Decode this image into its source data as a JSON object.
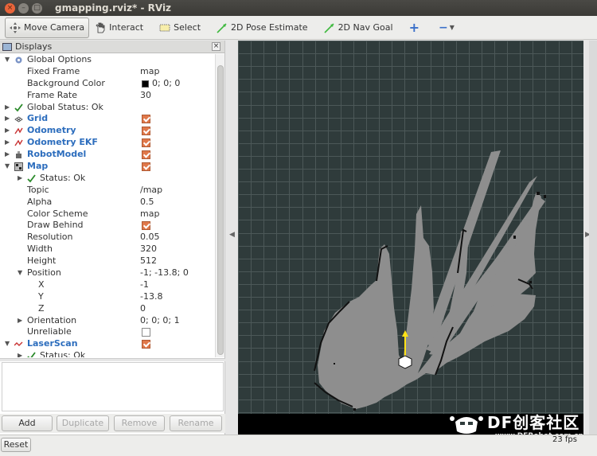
{
  "window": {
    "title": "gmapping.rviz* - RViz",
    "close_glyph": "×",
    "min_glyph": "–",
    "max_glyph": "□"
  },
  "toolbar": {
    "move_camera": "Move Camera",
    "interact": "Interact",
    "select": "Select",
    "pose_estimate": "2D Pose Estimate",
    "nav_goal": "2D Nav Goal",
    "add_tool": "+",
    "remove_tool": "−"
  },
  "displays_panel": {
    "title": "Displays",
    "close_glyph": "×",
    "rows": [
      {
        "depth": 0,
        "arrow": "▼",
        "icon": "gear",
        "label": "Global Options",
        "value": "",
        "style": "plain"
      },
      {
        "depth": 1,
        "label": "Fixed Frame",
        "value": "map"
      },
      {
        "depth": 1,
        "label": "Background Color",
        "value": "0; 0; 0",
        "swatch": "#000000"
      },
      {
        "depth": 1,
        "label": "Frame Rate",
        "value": "30"
      },
      {
        "depth": 0,
        "arrow": "▶",
        "icon": "check",
        "label": "Global Status: Ok",
        "value": ""
      },
      {
        "depth": 0,
        "arrow": "▶",
        "icon": "grid",
        "label": "Grid",
        "check": true,
        "style": "blue"
      },
      {
        "depth": 0,
        "arrow": "▶",
        "icon": "odom",
        "label": "Odometry",
        "check": true,
        "style": "blue"
      },
      {
        "depth": 0,
        "arrow": "▶",
        "icon": "odom",
        "label": "Odometry EKF",
        "check": true,
        "style": "blue"
      },
      {
        "depth": 0,
        "arrow": "▶",
        "icon": "robot",
        "label": "RobotModel",
        "check": true,
        "style": "blue"
      },
      {
        "depth": 0,
        "arrow": "▼",
        "icon": "map",
        "label": "Map",
        "check": true,
        "style": "blue"
      },
      {
        "depth": 1,
        "arrow": "▶",
        "icon": "check",
        "label": "Status: Ok",
        "value": ""
      },
      {
        "depth": 1,
        "label": "Topic",
        "value": "/map"
      },
      {
        "depth": 1,
        "label": "Alpha",
        "value": "0.5"
      },
      {
        "depth": 1,
        "label": "Color Scheme",
        "value": "map"
      },
      {
        "depth": 1,
        "label": "Draw Behind",
        "check": true
      },
      {
        "depth": 1,
        "label": "Resolution",
        "value": "0.05"
      },
      {
        "depth": 1,
        "label": "Width",
        "value": "320"
      },
      {
        "depth": 1,
        "label": "Height",
        "value": "512"
      },
      {
        "depth": 1,
        "arrow": "▼",
        "label": "Position",
        "value": "-1; -13.8; 0"
      },
      {
        "depth": 2,
        "label": "X",
        "value": "-1"
      },
      {
        "depth": 2,
        "label": "Y",
        "value": "-13.8"
      },
      {
        "depth": 2,
        "label": "Z",
        "value": "0"
      },
      {
        "depth": 1,
        "arrow": "▶",
        "label": "Orientation",
        "value": "0; 0; 0; 1"
      },
      {
        "depth": 1,
        "label": "Unreliable",
        "check": false
      },
      {
        "depth": 0,
        "arrow": "▼",
        "icon": "laser",
        "label": "LaserScan",
        "check": true,
        "style": "blue"
      },
      {
        "depth": 1,
        "arrow": "▶",
        "icon": "check",
        "label": "Status: Ok",
        "value": ""
      }
    ],
    "buttons": {
      "add": "Add",
      "duplicate": "Duplicate",
      "remove": "Remove",
      "rename": "Rename"
    }
  },
  "view_arrows": {
    "left": "◀",
    "right": "▶"
  },
  "statusbar": {
    "reset": "Reset",
    "fps": "23 fps"
  },
  "watermark": {
    "brand": "DF创客社区",
    "url": "www.DFRobot.com.cn"
  },
  "colors": {
    "accent_check": "#e0784a",
    "display_blue": "#2c6dbd",
    "view_bg": "#2f3b3b",
    "grid_line": "#4c5858",
    "map_free": "#8e8e8e"
  }
}
